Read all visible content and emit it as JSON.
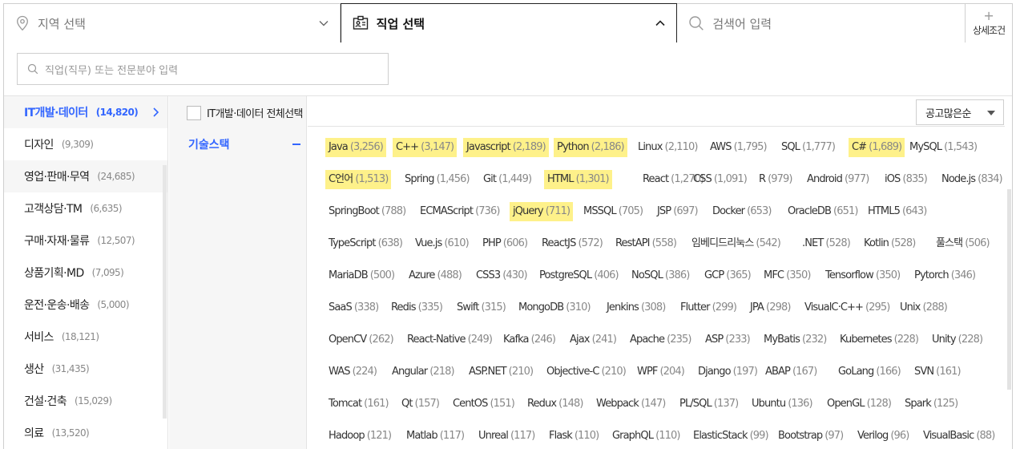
{
  "topbar": {
    "region": {
      "label": "지역 선택",
      "icon": "location-pin-icon"
    },
    "job": {
      "label": "직업 선택",
      "icon": "id-card-icon"
    },
    "search": {
      "placeholder": "검색어 입력",
      "icon": "search-icon"
    },
    "detail": {
      "plus": "+",
      "label": "상세조건"
    }
  },
  "job_search": {
    "placeholder": "직업(직무) 또는 전문분야 입력"
  },
  "categories": [
    {
      "name": "IT개발·데이터",
      "count": "(14,820)",
      "active": true
    },
    {
      "name": "디자인",
      "count": "(9,309)"
    },
    {
      "name": "영업·판매·무역",
      "count": "(24,685)"
    },
    {
      "name": "고객상담·TM",
      "count": "(6,635)"
    },
    {
      "name": "구매·자재·물류",
      "count": "(12,507)"
    },
    {
      "name": "상품기획·MD",
      "count": "(7,095)"
    },
    {
      "name": "운전·운송·배송",
      "count": "(5,000)"
    },
    {
      "name": "서비스",
      "count": "(18,121)"
    },
    {
      "name": "생산",
      "count": "(31,435)"
    },
    {
      "name": "건설·건축",
      "count": "(15,029)"
    },
    {
      "name": "의료",
      "count": "(13,520)"
    }
  ],
  "sub_category": {
    "name": "기술스택"
  },
  "select_all": {
    "label": "IT개발·데이터 전체선택"
  },
  "sort": {
    "label": "공고많은순"
  },
  "highlight_color": "#fef18a",
  "accent_color": "#3366ff",
  "tech_rows": [
    [
      {
        "name": "Java",
        "count": "(3,256)",
        "hl": true
      },
      {
        "name": "C++",
        "count": "(3,147)",
        "hl": true
      },
      {
        "name": "Javascript",
        "count": "(2,189)",
        "hl": true
      },
      {
        "name": "Python",
        "count": "(2,186)",
        "hl": true
      },
      {
        "name": "Linux",
        "count": "(2,110)"
      },
      {
        "name": "AWS",
        "count": "(1,795)"
      },
      {
        "name": "SQL",
        "count": "(1,777)"
      },
      {
        "name": "C#",
        "count": "(1,689)",
        "hl": true
      },
      {
        "name": "MySQL",
        "count": "(1,543)"
      }
    ],
    [
      {
        "name": "C언어",
        "count": "(1,513)",
        "hl": true
      },
      {
        "name": "Spring",
        "count": "(1,456)"
      },
      {
        "name": "Git",
        "count": "(1,449)"
      },
      {
        "name": "HTML",
        "count": "(1,301)",
        "hl": true
      },
      {
        "name": "React",
        "count": "(1,270)"
      },
      {
        "name": "CSS",
        "count": "(1,091)"
      },
      {
        "name": "R",
        "count": "(979)"
      },
      {
        "name": "Android",
        "count": "(977)"
      },
      {
        "name": "iOS",
        "count": "(835)"
      },
      {
        "name": "Node.js",
        "count": "(834)"
      }
    ],
    [
      {
        "name": "SpringBoot",
        "count": "(788)"
      },
      {
        "name": "ECMAScript",
        "count": "(736)"
      },
      {
        "name": "jQuery",
        "count": "(711)",
        "hl": true
      },
      {
        "name": "MSSQL",
        "count": "(705)"
      },
      {
        "name": "JSP",
        "count": "(697)"
      },
      {
        "name": "Docker",
        "count": "(653)"
      },
      {
        "name": "OracleDB",
        "count": "(651)"
      },
      {
        "name": "HTML5",
        "count": "(643)"
      }
    ],
    [
      {
        "name": "TypeScript",
        "count": "(638)"
      },
      {
        "name": "Vue.js",
        "count": "(610)"
      },
      {
        "name": "PHP",
        "count": "(606)"
      },
      {
        "name": "ReactJS",
        "count": "(572)"
      },
      {
        "name": "RestAPI",
        "count": "(558)"
      },
      {
        "name": "임베디드리눅스",
        "count": "(542)"
      },
      {
        "name": ".NET",
        "count": "(528)"
      },
      {
        "name": "Kotlin",
        "count": "(528)"
      },
      {
        "name": "풀스택",
        "count": "(506)"
      }
    ],
    [
      {
        "name": "MariaDB",
        "count": "(500)"
      },
      {
        "name": "Azure",
        "count": "(488)"
      },
      {
        "name": "CSS3",
        "count": "(430)"
      },
      {
        "name": "PostgreSQL",
        "count": "(406)"
      },
      {
        "name": "NoSQL",
        "count": "(386)"
      },
      {
        "name": "GCP",
        "count": "(365)"
      },
      {
        "name": "MFC",
        "count": "(350)"
      },
      {
        "name": "Tensorflow",
        "count": "(350)"
      },
      {
        "name": "Pytorch",
        "count": "(346)"
      }
    ],
    [
      {
        "name": "SaaS",
        "count": "(338)"
      },
      {
        "name": "Redis",
        "count": "(335)"
      },
      {
        "name": "Swift",
        "count": "(315)"
      },
      {
        "name": "MongoDB",
        "count": "(310)"
      },
      {
        "name": "Jenkins",
        "count": "(308)"
      },
      {
        "name": "Flutter",
        "count": "(299)"
      },
      {
        "name": "JPA",
        "count": "(298)"
      },
      {
        "name": "VisualC·C++",
        "count": "(295)"
      },
      {
        "name": "Unix",
        "count": "(288)"
      }
    ],
    [
      {
        "name": "OpenCV",
        "count": "(262)"
      },
      {
        "name": "React-Native",
        "count": "(249)"
      },
      {
        "name": "Kafka",
        "count": "(246)"
      },
      {
        "name": "Ajax",
        "count": "(241)"
      },
      {
        "name": "Apache",
        "count": "(235)"
      },
      {
        "name": "ASP",
        "count": "(233)"
      },
      {
        "name": "MyBatis",
        "count": "(232)"
      },
      {
        "name": "Kubernetes",
        "count": "(228)"
      },
      {
        "name": "Unity",
        "count": "(228)"
      }
    ],
    [
      {
        "name": "WAS",
        "count": "(224)"
      },
      {
        "name": "Angular",
        "count": "(218)"
      },
      {
        "name": "ASP.NET",
        "count": "(210)"
      },
      {
        "name": "Objective-C",
        "count": "(210)"
      },
      {
        "name": "WPF",
        "count": "(204)"
      },
      {
        "name": "Django",
        "count": "(197)"
      },
      {
        "name": "ABAP",
        "count": "(167)"
      },
      {
        "name": "GoLang",
        "count": "(166)"
      },
      {
        "name": "SVN",
        "count": "(161)"
      }
    ],
    [
      {
        "name": "Tomcat",
        "count": "(161)"
      },
      {
        "name": "Qt",
        "count": "(157)"
      },
      {
        "name": "CentOS",
        "count": "(151)"
      },
      {
        "name": "Redux",
        "count": "(148)"
      },
      {
        "name": "Webpack",
        "count": "(147)"
      },
      {
        "name": "PL/SQL",
        "count": "(137)"
      },
      {
        "name": "Ubuntu",
        "count": "(136)"
      },
      {
        "name": "OpenGL",
        "count": "(128)"
      },
      {
        "name": "Spark",
        "count": "(125)"
      }
    ],
    [
      {
        "name": "Hadoop",
        "count": "(121)"
      },
      {
        "name": "Matlab",
        "count": "(117)"
      },
      {
        "name": "Unreal",
        "count": "(117)"
      },
      {
        "name": "Flask",
        "count": "(110)"
      },
      {
        "name": "GraphQL",
        "count": "(110)"
      },
      {
        "name": "ElasticStack",
        "count": "(99)"
      },
      {
        "name": "Bootstrap",
        "count": "(97)"
      },
      {
        "name": "Verilog",
        "count": "(96)"
      },
      {
        "name": "VisualBasic",
        "count": "(88)"
      }
    ]
  ]
}
